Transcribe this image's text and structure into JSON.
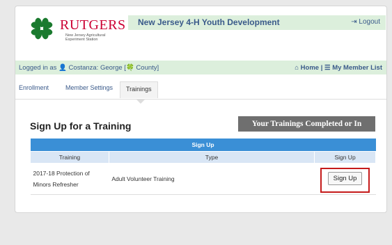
{
  "brand": {
    "name": "RUTGERS",
    "subtitle": "New Jersey Agricultural Experiment Station",
    "app_title": "New Jersey 4-H Youth Development",
    "logout_label": "Logout"
  },
  "session": {
    "logged_in_text": "Logged in as",
    "user_name": "Costanza: George",
    "county_text": "County]",
    "home_label": "Home",
    "member_list_label": "My Member List"
  },
  "tabs": [
    {
      "label": "Enrollment"
    },
    {
      "label": "Member Settings"
    },
    {
      "label": "Trainings"
    }
  ],
  "page": {
    "heading": "Sign Up for a Training",
    "completed_button": "Your Trainings Completed or In Progress"
  },
  "table": {
    "caption": "Sign Up",
    "columns": [
      "Training",
      "Type",
      "Sign Up"
    ],
    "rows": [
      {
        "training": "2017-18 Protection of Minors Refresher",
        "type": "Adult Volunteer Training",
        "action": "Sign Up"
      }
    ]
  },
  "colors": {
    "accent_green": "#dcefdc",
    "header_blue": "#3a8fd6",
    "highlight_red": "#c51a1a",
    "brand_red": "#cc0033"
  }
}
